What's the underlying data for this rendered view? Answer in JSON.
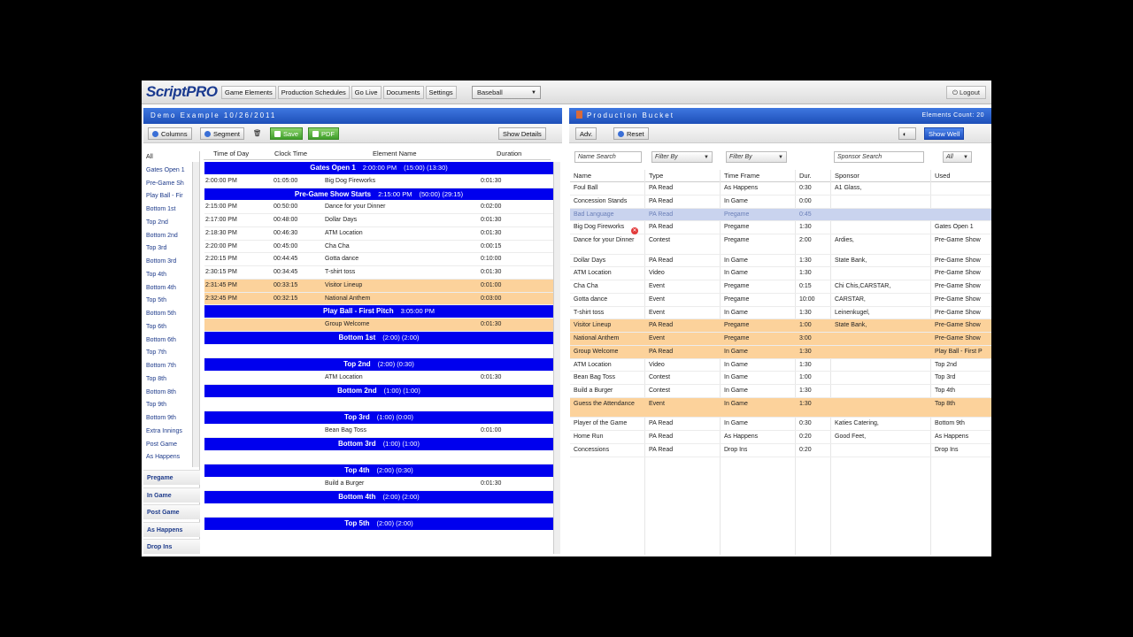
{
  "app": {
    "logo": "ScriptPRO",
    "nav": [
      "Game Elements",
      "Production Schedules",
      "Go Live",
      "Documents",
      "Settings"
    ],
    "sport": "Baseball",
    "logout": "Logout"
  },
  "left": {
    "title": "Demo Example 10/26/2011",
    "toolbar": {
      "columns": "Columns",
      "segment": "Segment",
      "save": "Save",
      "pdf": "PDF",
      "show_details": "Show Details"
    },
    "headers": [
      "Time of Day",
      "Clock Time",
      "Element Name",
      "Duration"
    ],
    "sidebar": [
      "All",
      "Gates Open 1",
      "Pre-Game Sh",
      "Play Ball - Fir",
      "Bottom 1st",
      "Top 2nd",
      "Bottom 2nd",
      "Top 3rd",
      "Bottom 3rd",
      "Top 4th",
      "Bottom 4th",
      "Top 5th",
      "Bottom 5th",
      "Top 6th",
      "Bottom 6th",
      "Top 7th",
      "Bottom 7th",
      "Top 8th",
      "Bottom 8th",
      "Top 9th",
      "Bottom 9th",
      "Extra Innings",
      "Post Game",
      "As Happens"
    ],
    "categories": [
      "Pregame",
      "In Game",
      "Post Game",
      "As Happens",
      "Drop Ins"
    ],
    "rows": [
      {
        "kind": "seg",
        "name": "Gates Open 1",
        "time": "2:00:00 PM",
        "extra": "(15:00)   (13:30)"
      },
      {
        "kind": "item",
        "tod": "2:00:00 PM",
        "clock": "01:05:00",
        "name": "Big Dog Fireworks",
        "dur": "0:01:30"
      },
      {
        "kind": "seg",
        "name": "Pre-Game Show Starts",
        "time": "2:15:00 PM",
        "extra": "(50:00)   (29:15)"
      },
      {
        "kind": "item",
        "tod": "2:15:00 PM",
        "clock": "00:50:00",
        "name": "Dance for your Dinner",
        "dur": "0:02:00"
      },
      {
        "kind": "item",
        "tod": "2:17:00 PM",
        "clock": "00:48:00",
        "name": "Dollar Days",
        "dur": "0:01:30"
      },
      {
        "kind": "item",
        "tod": "2:18:30 PM",
        "clock": "00:46:30",
        "name": "ATM Location",
        "dur": "0:01:30"
      },
      {
        "kind": "item",
        "tod": "2:20:00 PM",
        "clock": "00:45:00",
        "name": "Cha Cha",
        "dur": "0:00:15"
      },
      {
        "kind": "item",
        "tod": "2:20:15 PM",
        "clock": "00:44:45",
        "name": "Gotta dance",
        "dur": "0:10:00"
      },
      {
        "kind": "item",
        "tod": "2:30:15 PM",
        "clock": "00:34:45",
        "name": "T-shirt toss",
        "dur": "0:01:30"
      },
      {
        "kind": "orange",
        "tod": "2:31:45 PM",
        "clock": "00:33:15",
        "name": "Visitor Lineup",
        "dur": "0:01:00"
      },
      {
        "kind": "orange",
        "tod": "2:32:45 PM",
        "clock": "00:32:15",
        "name": "National Anthem",
        "dur": "0:03:00"
      },
      {
        "kind": "seg",
        "name": "Play Ball - First Pitch",
        "time": "3:05:00 PM",
        "extra": ""
      },
      {
        "kind": "orange",
        "tod": "",
        "clock": "",
        "name": "Group Welcome",
        "dur": "0:01:30"
      },
      {
        "kind": "seg",
        "name": "Bottom 1st",
        "time": "",
        "extra": "(2:00)   (2:00)"
      },
      {
        "kind": "blank"
      },
      {
        "kind": "seg",
        "name": "Top 2nd",
        "time": "",
        "extra": "(2:00)   (0:30)"
      },
      {
        "kind": "item",
        "tod": "",
        "clock": "",
        "name": "ATM Location",
        "dur": "0:01:30"
      },
      {
        "kind": "seg",
        "name": "Bottom 2nd",
        "time": "",
        "extra": "(1:00)   (1:00)"
      },
      {
        "kind": "blank"
      },
      {
        "kind": "seg",
        "name": "Top 3rd",
        "time": "",
        "extra": "(1:00)   (0:00)"
      },
      {
        "kind": "item",
        "tod": "",
        "clock": "",
        "name": "Bean Bag Toss",
        "dur": "0:01:00"
      },
      {
        "kind": "seg",
        "name": "Bottom 3rd",
        "time": "",
        "extra": "(1:00)   (1:00)"
      },
      {
        "kind": "blank"
      },
      {
        "kind": "seg",
        "name": "Top 4th",
        "time": "",
        "extra": "(2:00)   (0:30)"
      },
      {
        "kind": "item",
        "tod": "",
        "clock": "",
        "name": "Build a Burger",
        "dur": "0:01:30"
      },
      {
        "kind": "seg",
        "name": "Bottom 4th",
        "time": "",
        "extra": "(2:00)   (2:00)"
      },
      {
        "kind": "blank"
      },
      {
        "kind": "seg",
        "name": "Top 5th",
        "time": "",
        "extra": "(2:00)   (2:00)"
      }
    ]
  },
  "right": {
    "title": "Production Bucket",
    "count": "Elements Count: 20",
    "toolbar": {
      "adv": "Adv.",
      "reset": "Reset",
      "show_well": "Show Well"
    },
    "filters": {
      "name": "Name Search",
      "filter1": "Filter By",
      "filter2": "Filter By",
      "sponsor": "Sponsor Search",
      "all": "All"
    },
    "headers": [
      "Name",
      "Type",
      "Time Frame",
      "Dur.",
      "Sponsor",
      "Used"
    ],
    "drag_row": {
      "name": "Bad Language",
      "type": "PA Read",
      "frame": "Pregame",
      "dur": "0:45"
    },
    "rows": [
      {
        "name": "Foul Ball",
        "type": "PA Read",
        "frame": "As Happens",
        "dur": "0:30",
        "sponsor": "A1 Glass,",
        "used": "",
        "hl": false
      },
      {
        "name": "Concession Stands",
        "type": "PA Read",
        "frame": "In Game",
        "dur": "0:00",
        "sponsor": "",
        "used": "",
        "hl": false
      },
      {
        "name": "Bad Language",
        "type": "PA Read",
        "frame": "Pregame",
        "dur": "0:45",
        "sponsor": "",
        "used": "",
        "hl": "drag"
      },
      {
        "name": "Big Dog Fireworks",
        "type": "PA Read",
        "frame": "Pregame",
        "dur": "1:30",
        "sponsor": "",
        "used": "Gates Open 1",
        "hl": false
      },
      {
        "name": "Dance for your Dinner",
        "type": "Contest",
        "frame": "Pregame",
        "dur": "2:00",
        "sponsor": "Ardies,",
        "used": "Pre-Game Show",
        "hl": false,
        "tall": true
      },
      {
        "name": "Dollar Days",
        "type": "PA Read",
        "frame": "In Game",
        "dur": "1:30",
        "sponsor": "State Bank,",
        "used": "Pre-Game Show",
        "hl": false
      },
      {
        "name": "ATM Location",
        "type": "Video",
        "frame": "In Game",
        "dur": "1:30",
        "sponsor": "",
        "used": "Pre-Game Show",
        "hl": false
      },
      {
        "name": "Cha Cha",
        "type": "Event",
        "frame": "Pregame",
        "dur": "0:15",
        "sponsor": "Chi Chis,CARSTAR,",
        "used": "Pre-Game Show",
        "hl": false
      },
      {
        "name": "Gotta dance",
        "type": "Event",
        "frame": "Pregame",
        "dur": "10:00",
        "sponsor": "CARSTAR,",
        "used": "Pre-Game Show",
        "hl": false
      },
      {
        "name": "T-shirt toss",
        "type": "Event",
        "frame": "In Game",
        "dur": "1:30",
        "sponsor": "Leinenkugel,",
        "used": "Pre-Game Show",
        "hl": false
      },
      {
        "name": "Visitor Lineup",
        "type": "PA Read",
        "frame": "Pregame",
        "dur": "1:00",
        "sponsor": "State Bank,",
        "used": "Pre-Game Show",
        "hl": true
      },
      {
        "name": "National Anthem",
        "type": "Event",
        "frame": "Pregame",
        "dur": "3:00",
        "sponsor": "",
        "used": "Pre-Game Show",
        "hl": true
      },
      {
        "name": "Group Welcome",
        "type": "PA Read",
        "frame": "In Game",
        "dur": "1:30",
        "sponsor": "",
        "used": "Play Ball - First P",
        "hl": true
      },
      {
        "name": "ATM Location",
        "type": "Video",
        "frame": "In Game",
        "dur": "1:30",
        "sponsor": "",
        "used": "Top 2nd",
        "hl": false
      },
      {
        "name": "Bean Bag Toss",
        "type": "Contest",
        "frame": "In Game",
        "dur": "1:00",
        "sponsor": "",
        "used": "Top 3rd",
        "hl": false
      },
      {
        "name": "Build a Burger",
        "type": "Contest",
        "frame": "In Game",
        "dur": "1:30",
        "sponsor": "",
        "used": "Top 4th",
        "hl": false
      },
      {
        "name": "Guess the Attendance",
        "type": "Event",
        "frame": "In Game",
        "dur": "1:30",
        "sponsor": "",
        "used": "Top 8th",
        "hl": true,
        "tall": true
      },
      {
        "name": "Player of the Game",
        "type": "PA Read",
        "frame": "In Game",
        "dur": "0:30",
        "sponsor": "Katies Catering,",
        "used": "Bottom 9th",
        "hl": false
      },
      {
        "name": "Home Run",
        "type": "PA Read",
        "frame": "As Happens",
        "dur": "0:20",
        "sponsor": "Good Feet,",
        "used": "As Happens",
        "hl": false
      },
      {
        "name": "Concessions",
        "type": "PA Read",
        "frame": "Drop Ins",
        "dur": "0:20",
        "sponsor": "",
        "used": "Drop Ins",
        "hl": false
      }
    ]
  }
}
